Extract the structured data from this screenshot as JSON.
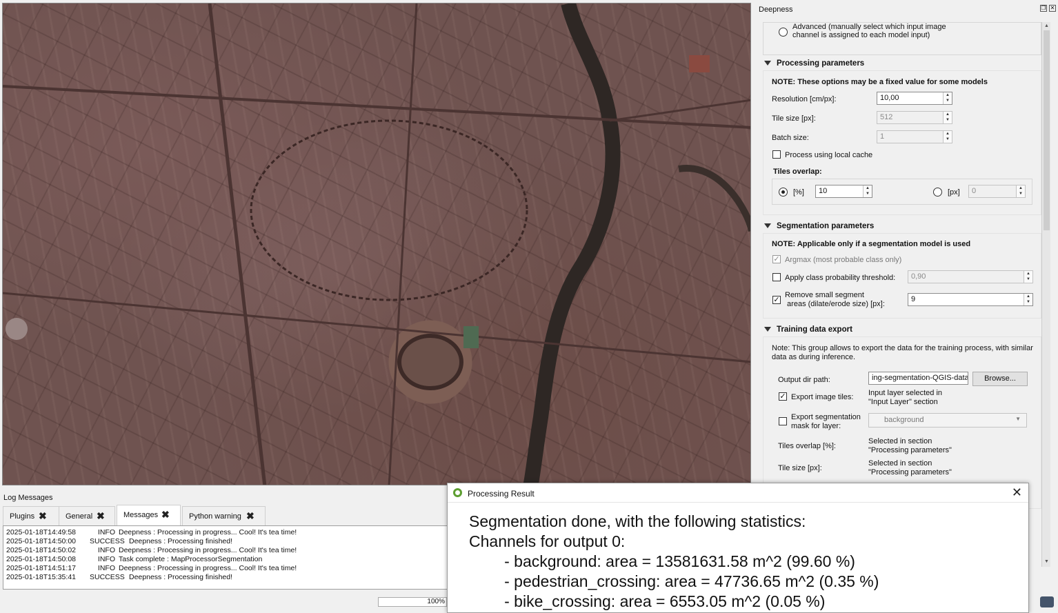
{
  "dock": {
    "title": "Deepness",
    "advanced_option": "Advanced (manually select which input image\nchannel is assigned to each model input)",
    "processing": {
      "header": "Processing parameters",
      "note": "NOTE: These options may be a fixed value for some models",
      "resolution_label": "Resolution [cm/px]:",
      "resolution_value": "10,00",
      "tile_size_label": "Tile size [px]:",
      "tile_size_value": "512",
      "batch_size_label": "Batch size:",
      "batch_size_value": "1",
      "local_cache_label": "Process using local cache",
      "tiles_overlap_label": "Tiles overlap:",
      "overlap_percent_label": "[%]",
      "overlap_percent_value": "10",
      "overlap_px_label": "[px]",
      "overlap_px_value": "0"
    },
    "segmentation": {
      "header": "Segmentation parameters",
      "note": "NOTE: Applicable only if a segmentation model is used",
      "argmax_label": "Argmax (most probable class only)",
      "threshold_label": "Apply class probability threshold:",
      "threshold_value": "0,90",
      "remove_small_label": "Remove small segment\n areas (dilate/erode size) [px]:",
      "remove_small_value": "9"
    },
    "training": {
      "header": "Training data export",
      "note": "Note: This group allows to export the data for the training process, with similar\ndata as during inference.",
      "output_dir_label": "Output dir path:",
      "output_dir_value": "ing-segmentation-QGIS-data",
      "browse_label": "Browse...",
      "export_tiles_label": "Export image tiles:",
      "export_tiles_info": "Input layer selected in\n\"Input Layer\" section",
      "export_mask_label": "Export segmentation\nmask for layer:",
      "mask_layer_value": "background",
      "tiles_overlap_label": "Tiles overlap [%]:",
      "tiles_overlap_info": "Selected in section\n\"Processing parameters\"",
      "tile_size_label": "Tile size [px]:",
      "tile_size_info": "Selected in section\n\"Processing parameters\""
    }
  },
  "log": {
    "title": "Log Messages",
    "tabs": [
      {
        "label": "Plugins"
      },
      {
        "label": "General"
      },
      {
        "label": "Messages"
      },
      {
        "label": "Python warning"
      }
    ],
    "lines": [
      {
        "time": "2025-01-18T14:49:58",
        "level": "INFO",
        "msg": "Deepness : Processing in progress... Cool! It's tea time!"
      },
      {
        "time": "2025-01-18T14:50:00",
        "level": "SUCCESS",
        "msg": "Deepness : Processing finished!"
      },
      {
        "time": "2025-01-18T14:50:02",
        "level": "INFO",
        "msg": "Deepness : Processing in progress... Cool! It's tea time!"
      },
      {
        "time": "2025-01-18T14:50:08",
        "level": "INFO",
        "msg": "Task complete : MapProcessorSegmentation"
      },
      {
        "time": "2025-01-18T14:51:17",
        "level": "INFO",
        "msg": "Deepness : Processing in progress... Cool! It's tea time!"
      },
      {
        "time": "2025-01-18T15:35:41",
        "level": "SUCCESS",
        "msg": "Deepness : Processing finished!"
      }
    ]
  },
  "status": {
    "progress_text": "100%",
    "progress_value": 1.0
  },
  "dialog": {
    "title": "Processing Result",
    "text": "Segmentation done, with the following statistics:\nChannels for output 0:\n        - background: area = 13581631.58 m^2 (99.60 %)\n        - pedestrian_crossing: area = 47736.65 m^2 (0.35 %)\n        - bike_crossing: area = 6553.05 m^2 (0.05 %)"
  }
}
